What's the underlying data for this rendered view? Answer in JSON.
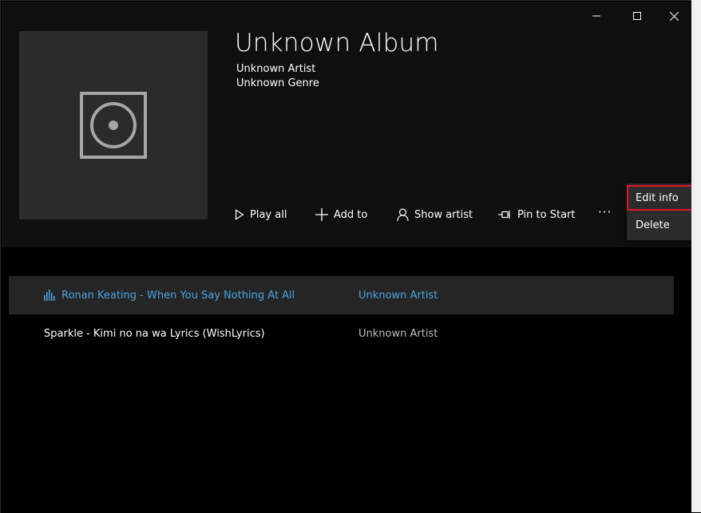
{
  "window": {
    "minimize_icon": "minimize-icon",
    "maximize_icon": "maximize-icon",
    "close_icon": "close-icon"
  },
  "album": {
    "title": "Unknown Album",
    "artist": "Unknown Artist",
    "genre": "Unknown Genre",
    "art_icon": "speaker-placeholder-icon"
  },
  "actions": {
    "play_all": "Play all",
    "add_to": "Add to",
    "show_artist": "Show artist",
    "pin_to_start": "Pin to Start",
    "more": "···"
  },
  "context_menu": {
    "edit_info": "Edit info",
    "delete": "Delete"
  },
  "tracks": [
    {
      "title": "Ronan Keating - When You Say Nothing At All",
      "artist": "Unknown Artist",
      "state": "playing"
    },
    {
      "title": "Sparkle - Kimi no na wa Lyrics (WishLyrics)",
      "artist": "Unknown Artist",
      "state": "normal"
    }
  ],
  "colors": {
    "accent": "#4aa3e0",
    "highlight_border": "#e81123",
    "header_bg": "#0f0f0f",
    "menu_bg": "#2b2b2b"
  }
}
